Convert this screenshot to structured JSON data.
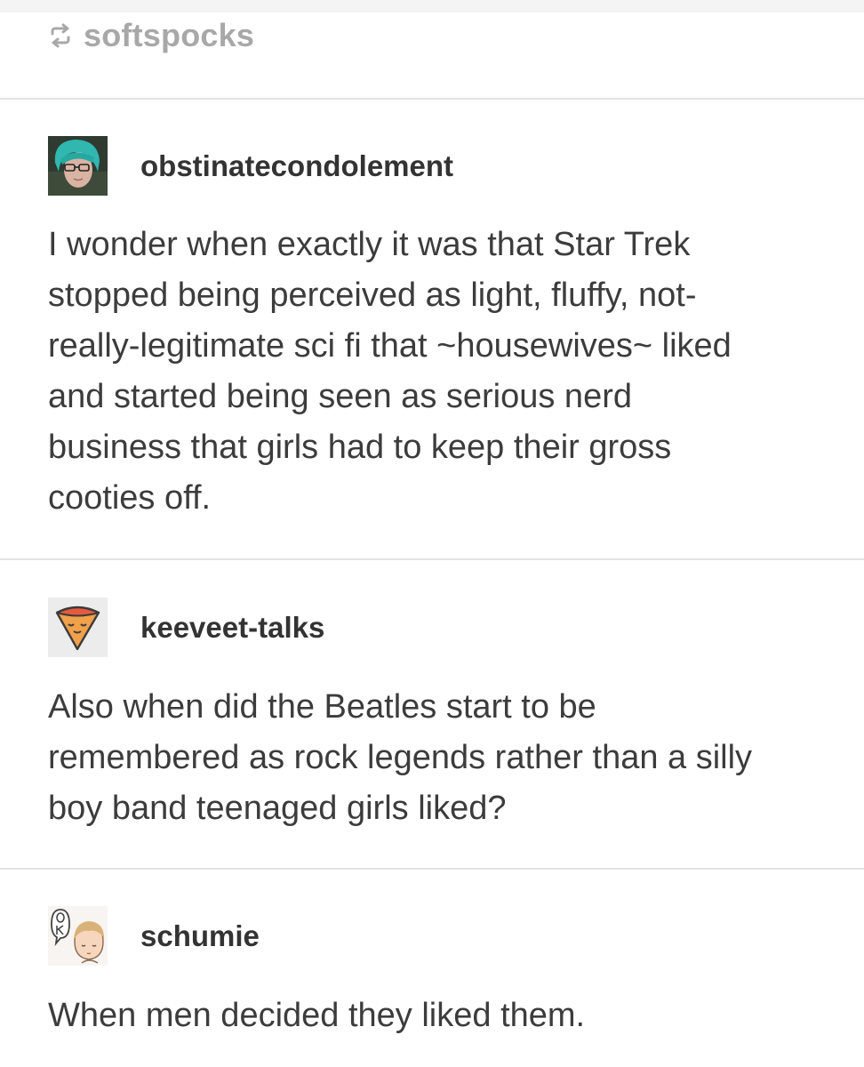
{
  "reblog": {
    "icon": "reblog-icon",
    "name": "softspocks"
  },
  "posts": [
    {
      "avatar_icon": "avatar-photo-icon",
      "username": "obstinatecondolement",
      "body": "I wonder when exactly it was that Star Trek\nstopped being perceived as light, fluffy, not-\nreally-legitimate sci fi that ~housewives~ liked\nand started being seen as serious nerd\nbusiness that girls had to keep their gross\ncooties off."
    },
    {
      "avatar_icon": "pizza-slice-icon",
      "username": "keeveet-talks",
      "body": "Also when did the Beatles start to be\nremembered as rock legends rather than a silly\nboy band teenaged girls liked?"
    },
    {
      "avatar_icon": "ok-speech-bubble-icon",
      "username": "schumie",
      "body": "When men decided they liked them."
    }
  ],
  "colors": {
    "reblog_text": "#a8a8a8",
    "username_text": "#333333",
    "body_text": "#3c3c3c",
    "divider": "#e3e3e3"
  }
}
